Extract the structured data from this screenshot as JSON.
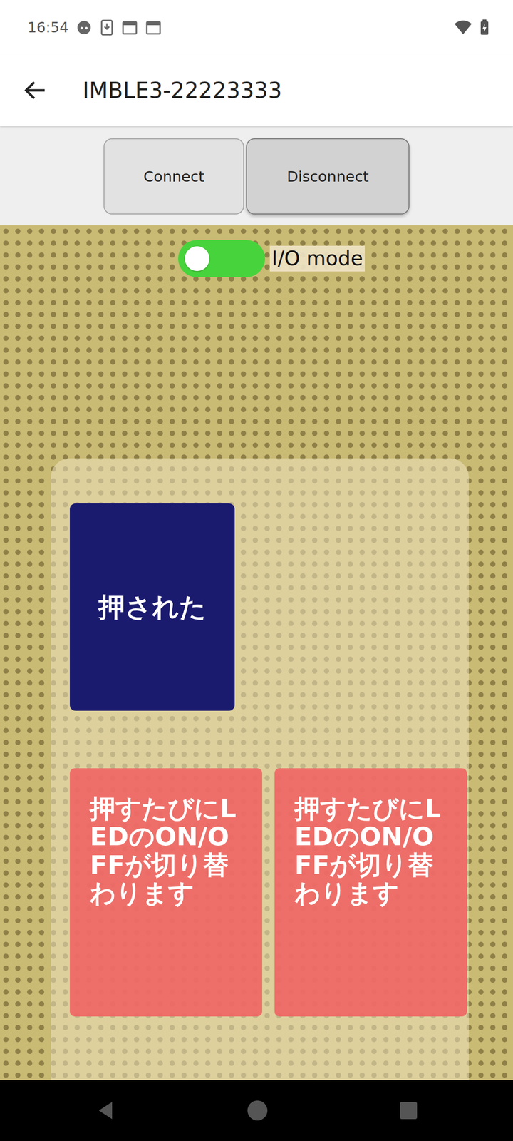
{
  "status_bar": {
    "time": "16:54"
  },
  "app_bar": {
    "title": "IMBLE3-22223333"
  },
  "buttons": [
    {
      "label": "Connect",
      "selected": false
    },
    {
      "label": "Disconnect",
      "selected": true
    }
  ],
  "io_mode": {
    "label": "I/O mode",
    "on": true
  },
  "push_button": {
    "label": "押された",
    "pressed": true
  },
  "leds": [
    {
      "label": "押すたびにLEDのON/OFFが切り替わります"
    },
    {
      "label": "押すたびにLEDのON/OFFが切り替わります"
    }
  ]
}
